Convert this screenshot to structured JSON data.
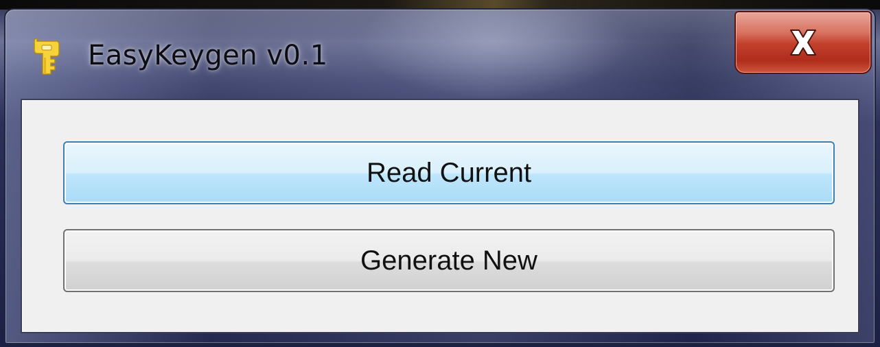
{
  "window": {
    "title": "EasyKeygen v0.1",
    "icon": "key-icon",
    "close_icon": "close-icon",
    "close_color": "#c2402c"
  },
  "buttons": {
    "read_current_label": "Read Current",
    "generate_new_label": "Generate New"
  },
  "colors": {
    "focused_button": "#bee6fd",
    "client_background": "#f0f0f0"
  }
}
